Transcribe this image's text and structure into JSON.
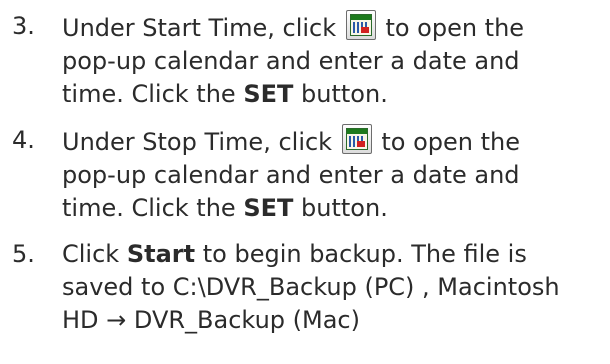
{
  "steps": [
    {
      "number": "3.",
      "line1_before": "Under Start Time, click",
      "line1_after": "to open the",
      "line2": "pop-up calendar and enter a date and",
      "line3_before": "time. Click the",
      "button": "SET",
      "line3_after": "button.",
      "icon": "calendar-icon"
    },
    {
      "number": "4.",
      "line1_before": "Under Stop Time, click",
      "line1_after": "to open the",
      "line2": "pop-up calendar and enter a date and",
      "line3_before": "time. Click the",
      "button": "SET",
      "line3_after": "button.",
      "icon": "calendar-icon"
    },
    {
      "number": "5.",
      "line1_before": "Click",
      "start_label": "Start",
      "line1_after": "to begin backup. The file is",
      "line2": "saved to C:\\DVR_Backup (PC) , Macintosh",
      "line3": "HD → DVR_Backup (Mac)"
    }
  ]
}
